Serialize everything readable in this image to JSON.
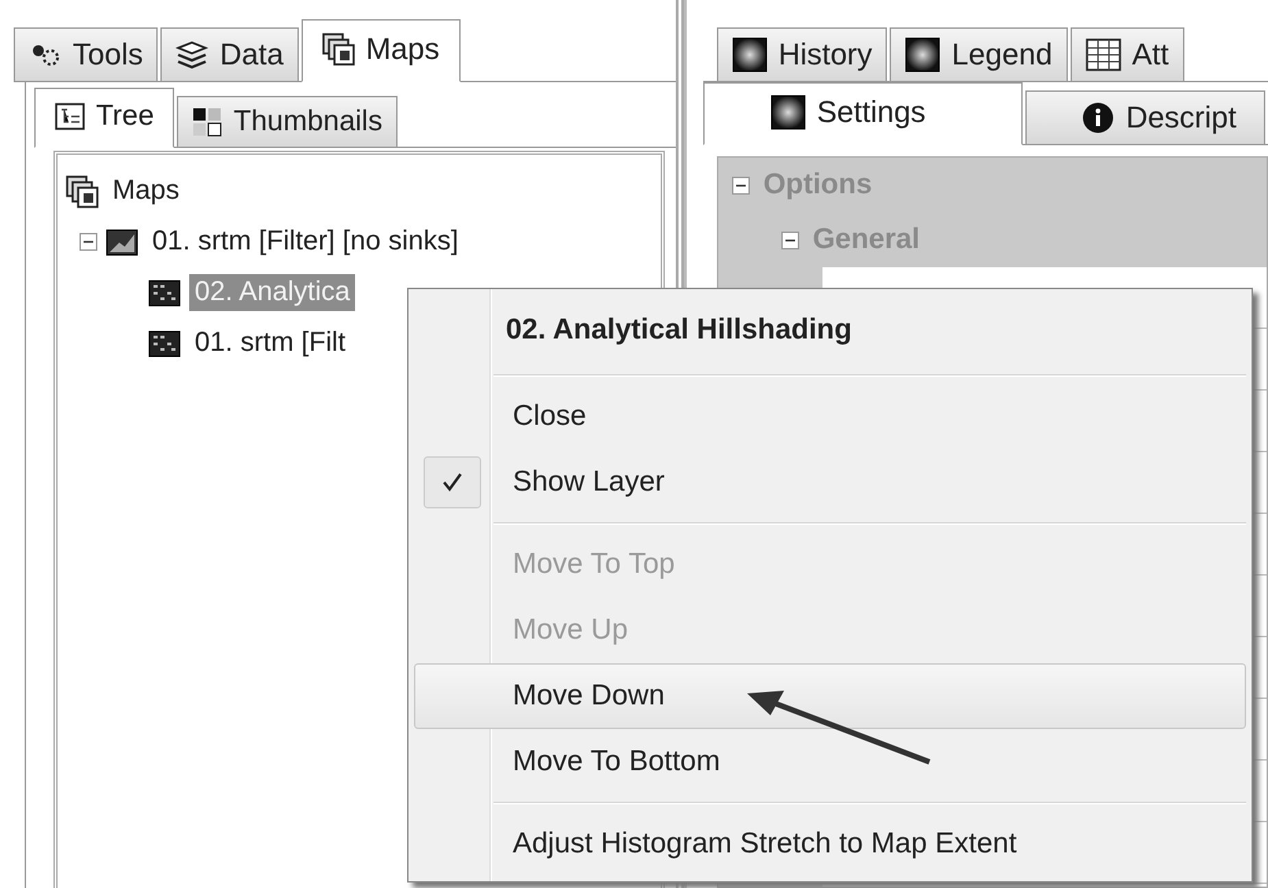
{
  "left_tabs": [
    {
      "label": "Tools",
      "selected": false
    },
    {
      "label": "Data",
      "selected": false
    },
    {
      "label": "Maps",
      "selected": true
    }
  ],
  "sub_tabs": [
    {
      "label": "Tree",
      "selected": true
    },
    {
      "label": "Thumbnails",
      "selected": false
    }
  ],
  "tree": {
    "label": "Maps",
    "children": [
      {
        "label": "01. srtm [Filter] [no sinks]",
        "expanded": true,
        "selected": false,
        "children": [
          {
            "label": "02. Analytica",
            "selected": true
          },
          {
            "label": "01. srtm [Filt",
            "selected": false
          }
        ]
      }
    ]
  },
  "right_tabs_top": [
    {
      "label": "History",
      "selected": false
    },
    {
      "label": "Legend",
      "selected": false
    },
    {
      "label": "Att",
      "selected": false
    }
  ],
  "right_tabs_bottom": [
    {
      "label": "Settings",
      "selected": true
    },
    {
      "label": "Descript",
      "selected": false
    }
  ],
  "properties": {
    "label": "Options",
    "expanded": true,
    "children": [
      {
        "label": "General",
        "expanded": true
      }
    ]
  },
  "context_menu": {
    "title": "02. Analytical Hillshading",
    "items": [
      {
        "kind": "separator"
      },
      {
        "kind": "item",
        "label": "Close",
        "checked": false,
        "disabled": false,
        "selected": false
      },
      {
        "kind": "item",
        "label": "Show Layer",
        "checked": true,
        "disabled": false,
        "selected": false
      },
      {
        "kind": "separator"
      },
      {
        "kind": "item",
        "label": "Move To Top",
        "checked": false,
        "disabled": true,
        "selected": false
      },
      {
        "kind": "item",
        "label": "Move Up",
        "checked": false,
        "disabled": true,
        "selected": false
      },
      {
        "kind": "item",
        "label": "Move Down",
        "checked": false,
        "disabled": false,
        "selected": true
      },
      {
        "kind": "item",
        "label": "Move To Bottom",
        "checked": false,
        "disabled": false,
        "selected": false
      },
      {
        "kind": "separator"
      },
      {
        "kind": "item",
        "label": "Adjust Histogram Stretch to Map Extent",
        "checked": false,
        "disabled": false,
        "selected": false
      }
    ]
  }
}
